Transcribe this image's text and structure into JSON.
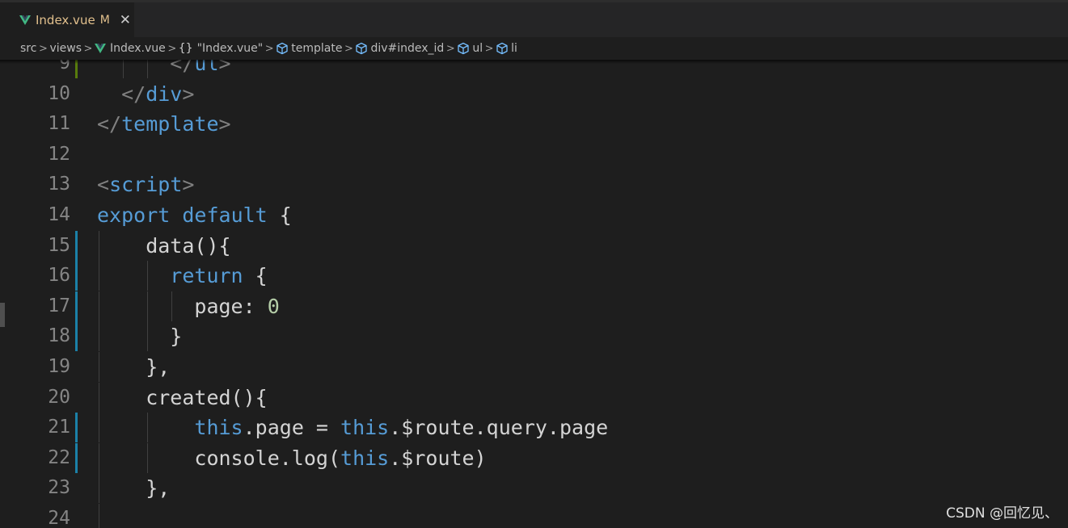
{
  "tab": {
    "filename": "Index.vue",
    "status": "M",
    "close": "✕"
  },
  "breadcrumb": {
    "items": [
      {
        "label": "src",
        "icon": "none"
      },
      {
        "label": "views",
        "icon": "none"
      },
      {
        "label": "Index.vue",
        "icon": "vue-logo-icon"
      },
      {
        "label": "\"Index.vue\"",
        "icon": "braces-icon",
        "icon_text": "{}"
      },
      {
        "label": "template",
        "icon": "cube-icon"
      },
      {
        "label": "div#index_id",
        "icon": "cube-icon"
      },
      {
        "label": "ul",
        "icon": "cube-icon"
      },
      {
        "label": "li",
        "icon": "cube-icon"
      }
    ],
    "separator": ">"
  },
  "colors": {
    "background": "#1e1e1e",
    "keyword": "#569cd6",
    "punctuation": "#808080",
    "text": "#d4d4d4",
    "number": "#b5cea8",
    "line_number": "#858585",
    "modified_tab": "#e2c08d",
    "gutter_modified": "#1b81a8",
    "gutter_added": "#587c0c",
    "vue_green": "#41b883"
  },
  "editor": {
    "lines": [
      {
        "n": "9",
        "tokens": [
          [
            "t-punc",
            "</"
          ],
          [
            "t-tag",
            "ul"
          ],
          [
            "t-punc",
            ">"
          ]
        ],
        "indent": 3,
        "guides": [
          1,
          2
        ]
      },
      {
        "n": "10",
        "tokens": [
          [
            "t-punc",
            "</"
          ],
          [
            "t-tag",
            "div"
          ],
          [
            "t-punc",
            ">"
          ]
        ],
        "indent": 1,
        "guides": []
      },
      {
        "n": "11",
        "tokens": [
          [
            "t-punc",
            "</"
          ],
          [
            "t-tag",
            "template"
          ],
          [
            "t-punc",
            ">"
          ]
        ],
        "indent": 0,
        "guides": []
      },
      {
        "n": "12",
        "tokens": [],
        "indent": 0,
        "guides": []
      },
      {
        "n": "13",
        "tokens": [
          [
            "t-punc",
            "<"
          ],
          [
            "t-tag",
            "script"
          ],
          [
            "t-punc",
            ">"
          ]
        ],
        "indent": 0,
        "guides": []
      },
      {
        "n": "14",
        "tokens": [
          [
            "t-kw",
            "export"
          ],
          [
            "t-txt",
            " "
          ],
          [
            "t-kw",
            "default"
          ],
          [
            "t-txt",
            " {"
          ]
        ],
        "indent": 0,
        "guides": []
      },
      {
        "n": "15",
        "tokens": [
          [
            "t-txt",
            "data(){"
          ]
        ],
        "indent": 2,
        "guides": [
          0
        ]
      },
      {
        "n": "16",
        "tokens": [
          [
            "t-kw",
            "return"
          ],
          [
            "t-txt",
            " {"
          ]
        ],
        "indent": 3,
        "guides": [
          0,
          2
        ]
      },
      {
        "n": "17",
        "tokens": [
          [
            "t-txt",
            "page: "
          ],
          [
            "t-num",
            "0"
          ]
        ],
        "indent": 4,
        "guides": [
          0,
          2,
          3
        ]
      },
      {
        "n": "18",
        "tokens": [
          [
            "t-txt",
            "}"
          ]
        ],
        "indent": 3,
        "guides": [
          0,
          2
        ]
      },
      {
        "n": "19",
        "tokens": [
          [
            "t-txt",
            "},"
          ]
        ],
        "indent": 2,
        "guides": [
          0
        ]
      },
      {
        "n": "20",
        "tokens": [
          [
            "t-txt",
            "created(){"
          ]
        ],
        "indent": 2,
        "guides": [
          0
        ]
      },
      {
        "n": "21",
        "tokens": [
          [
            "t-kw",
            "this"
          ],
          [
            "t-txt",
            ".page = "
          ],
          [
            "t-kw",
            "this"
          ],
          [
            "t-txt",
            ".$route.query.page"
          ]
        ],
        "indent": 4,
        "guides": [
          0,
          2
        ]
      },
      {
        "n": "22",
        "tokens": [
          [
            "t-txt",
            "console.log("
          ],
          [
            "t-kw",
            "this"
          ],
          [
            "t-txt",
            ".$route)"
          ]
        ],
        "indent": 4,
        "guides": [
          0,
          2
        ]
      },
      {
        "n": "23",
        "tokens": [
          [
            "t-txt",
            "},"
          ]
        ],
        "indent": 2,
        "guides": [
          0
        ]
      },
      {
        "n": "24",
        "tokens": [],
        "indent": 0,
        "guides": [
          0
        ]
      }
    ]
  },
  "watermark": "CSDN @回忆见、"
}
